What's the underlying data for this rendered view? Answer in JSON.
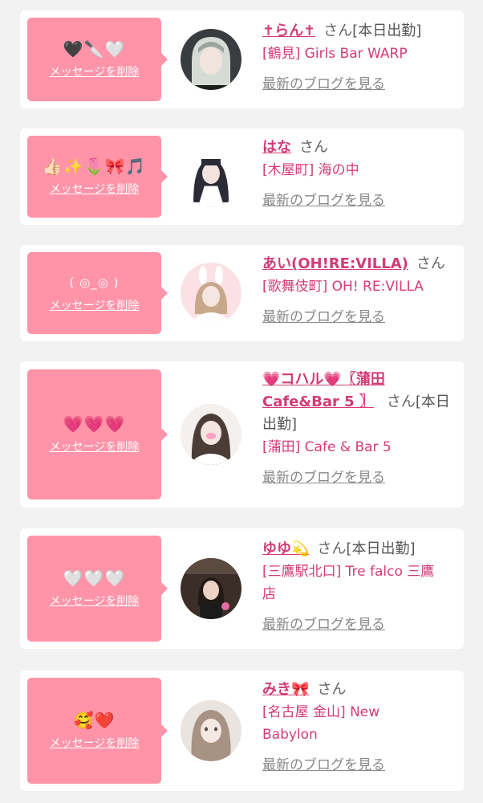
{
  "entries": [
    {
      "message": "🖤🔪🤍",
      "delete_label": "メッセージを削除",
      "name": "✝らん✝",
      "san": "さん",
      "suffix": "[本日出勤]",
      "shop": "[鶴見] Girls Bar WARP",
      "blog_label": "最新のブログを見る"
    },
    {
      "message": "👍🏻✨🌷🎀🎵",
      "delete_label": "メッセージを削除",
      "name": "はな",
      "san": "さん",
      "suffix": "",
      "shop": "[木屋町] 海の中",
      "blog_label": "最新のブログを見る"
    },
    {
      "message": "( ◎_◎ )",
      "delete_label": "メッセージを削除",
      "name": "あい(OH!RE:VILLA)",
      "san": "さん",
      "suffix": "",
      "shop": "[歌舞伎町] OH! RE:VILLA",
      "blog_label": "最新のブログを見る"
    },
    {
      "message": "💗💗💗",
      "delete_label": "メッセージを削除",
      "name_line1": "💗コハル💗〖蒲田",
      "name_line2": "Cafe&Bar 5 〗",
      "san": "さん",
      "suffix_line2": "[本日",
      "suffix_line3": "出勤]",
      "shop": "[蒲田] Cafe & Bar 5",
      "blog_label": "最新のブログを見る"
    },
    {
      "message": "🤍🤍🤍",
      "delete_label": "メッセージを削除",
      "name": "ゆゆ💫",
      "san": "さん",
      "suffix": "[本日出勤]",
      "shop_line1": "[三鷹駅北口] Tre falco 三鷹",
      "shop_line2": "店",
      "blog_label": "最新のブログを見る"
    },
    {
      "message": "🥰❤️",
      "delete_label": "メッセージを削除",
      "name": "みき🎀",
      "san": "さん",
      "suffix": "",
      "shop_line1": "[名古屋 金山] New",
      "shop_line2": "Babylon",
      "blog_label": "最新のブログを見る"
    }
  ],
  "colors": {
    "bubble": "#ff94a8",
    "accent": "#d23c78",
    "background": "#f2f2f2"
  }
}
